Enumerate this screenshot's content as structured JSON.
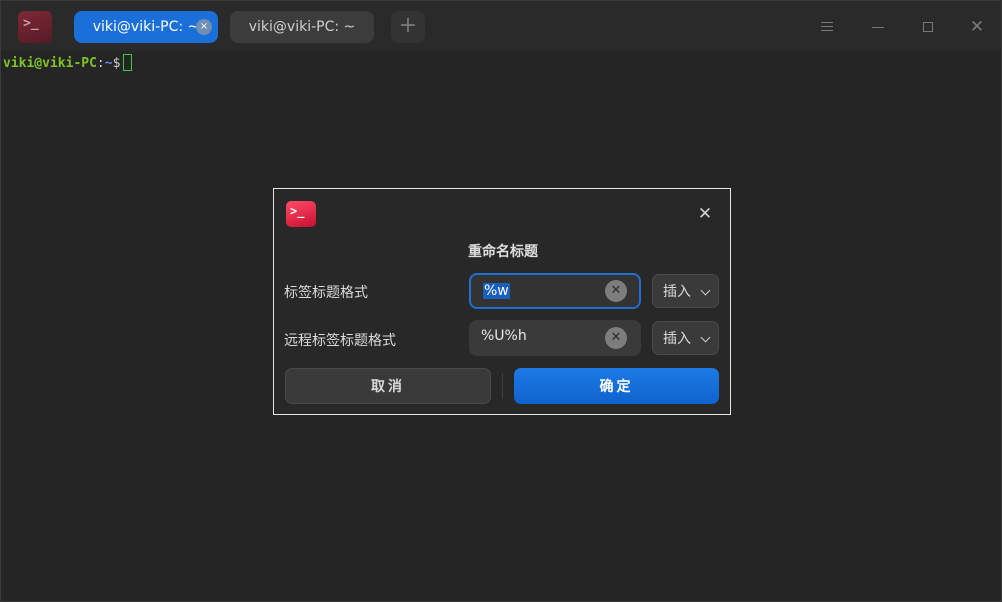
{
  "tabs": [
    {
      "label": "viki@viki-PC: ~",
      "active": true
    },
    {
      "label": "viki@viki-PC: ~",
      "active": false
    }
  ],
  "tab_close_glyph": "×",
  "add_tab_glyph": "+",
  "terminal": {
    "prompt_user": "viki@viki-PC",
    "prompt_sep": ":",
    "prompt_path": "~",
    "prompt_symbol": "$"
  },
  "dialog": {
    "title": "重命名标题",
    "close_glyph": "✕",
    "tab_title_format": {
      "label": "标签标题格式",
      "value": "%w",
      "insert_label": "插入"
    },
    "remote_tab_title_format": {
      "label": "远程标签标题格式",
      "value": "%U%h",
      "insert_label": "插入"
    },
    "cancel_label": "取消",
    "ok_label": "确定"
  },
  "colors": {
    "accent": "#1a6fd8",
    "prompt_user": "#7ec427",
    "prompt_path": "#5b8ee0",
    "cursor": "#3ec83e"
  },
  "icons": {
    "app": "terminal-icon",
    "menu": "hamburger-menu-icon",
    "minimize": "minimize-icon",
    "maximize": "maximize-icon",
    "close": "close-icon"
  }
}
